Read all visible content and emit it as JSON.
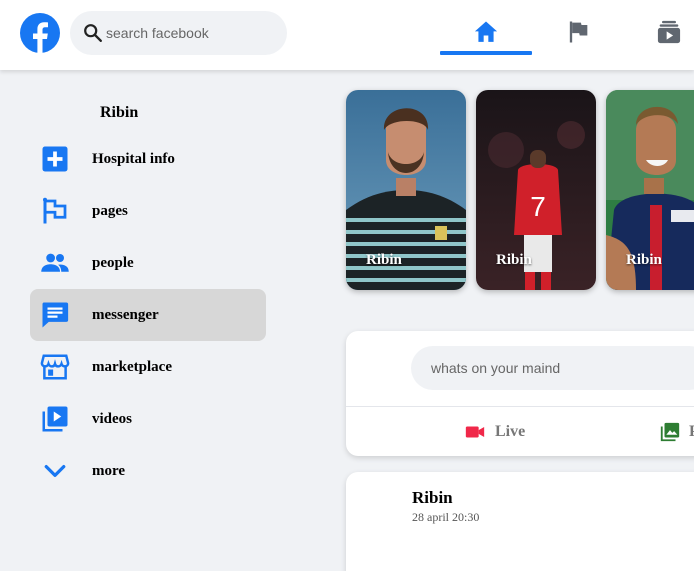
{
  "header": {
    "search_placeholder": "search facebook",
    "nav_tabs": [
      "home",
      "pages",
      "watch"
    ],
    "accent_color": "#1877f2"
  },
  "sidebar": {
    "profile_name": "Ribin",
    "items": [
      {
        "label": "Hospital info",
        "icon": "plus-box-icon",
        "active": false
      },
      {
        "label": "pages",
        "icon": "flag-icon",
        "active": false
      },
      {
        "label": "people",
        "icon": "people-icon",
        "active": false
      },
      {
        "label": "messenger",
        "icon": "message-icon",
        "active": true
      },
      {
        "label": "marketplace",
        "icon": "store-icon",
        "active": false
      },
      {
        "label": "videos",
        "icon": "video-library-icon",
        "active": false
      },
      {
        "label": "more",
        "icon": "chevron-down-icon",
        "active": false
      }
    ]
  },
  "stories": [
    {
      "name": "Ribin"
    },
    {
      "name": "Ribin"
    },
    {
      "name": "Ribin"
    }
  ],
  "composer": {
    "placeholder": "whats on your maind",
    "live_label": "Live",
    "photo_label": "P"
  },
  "post": {
    "author": "Ribin",
    "time": "28 april 20:30"
  }
}
